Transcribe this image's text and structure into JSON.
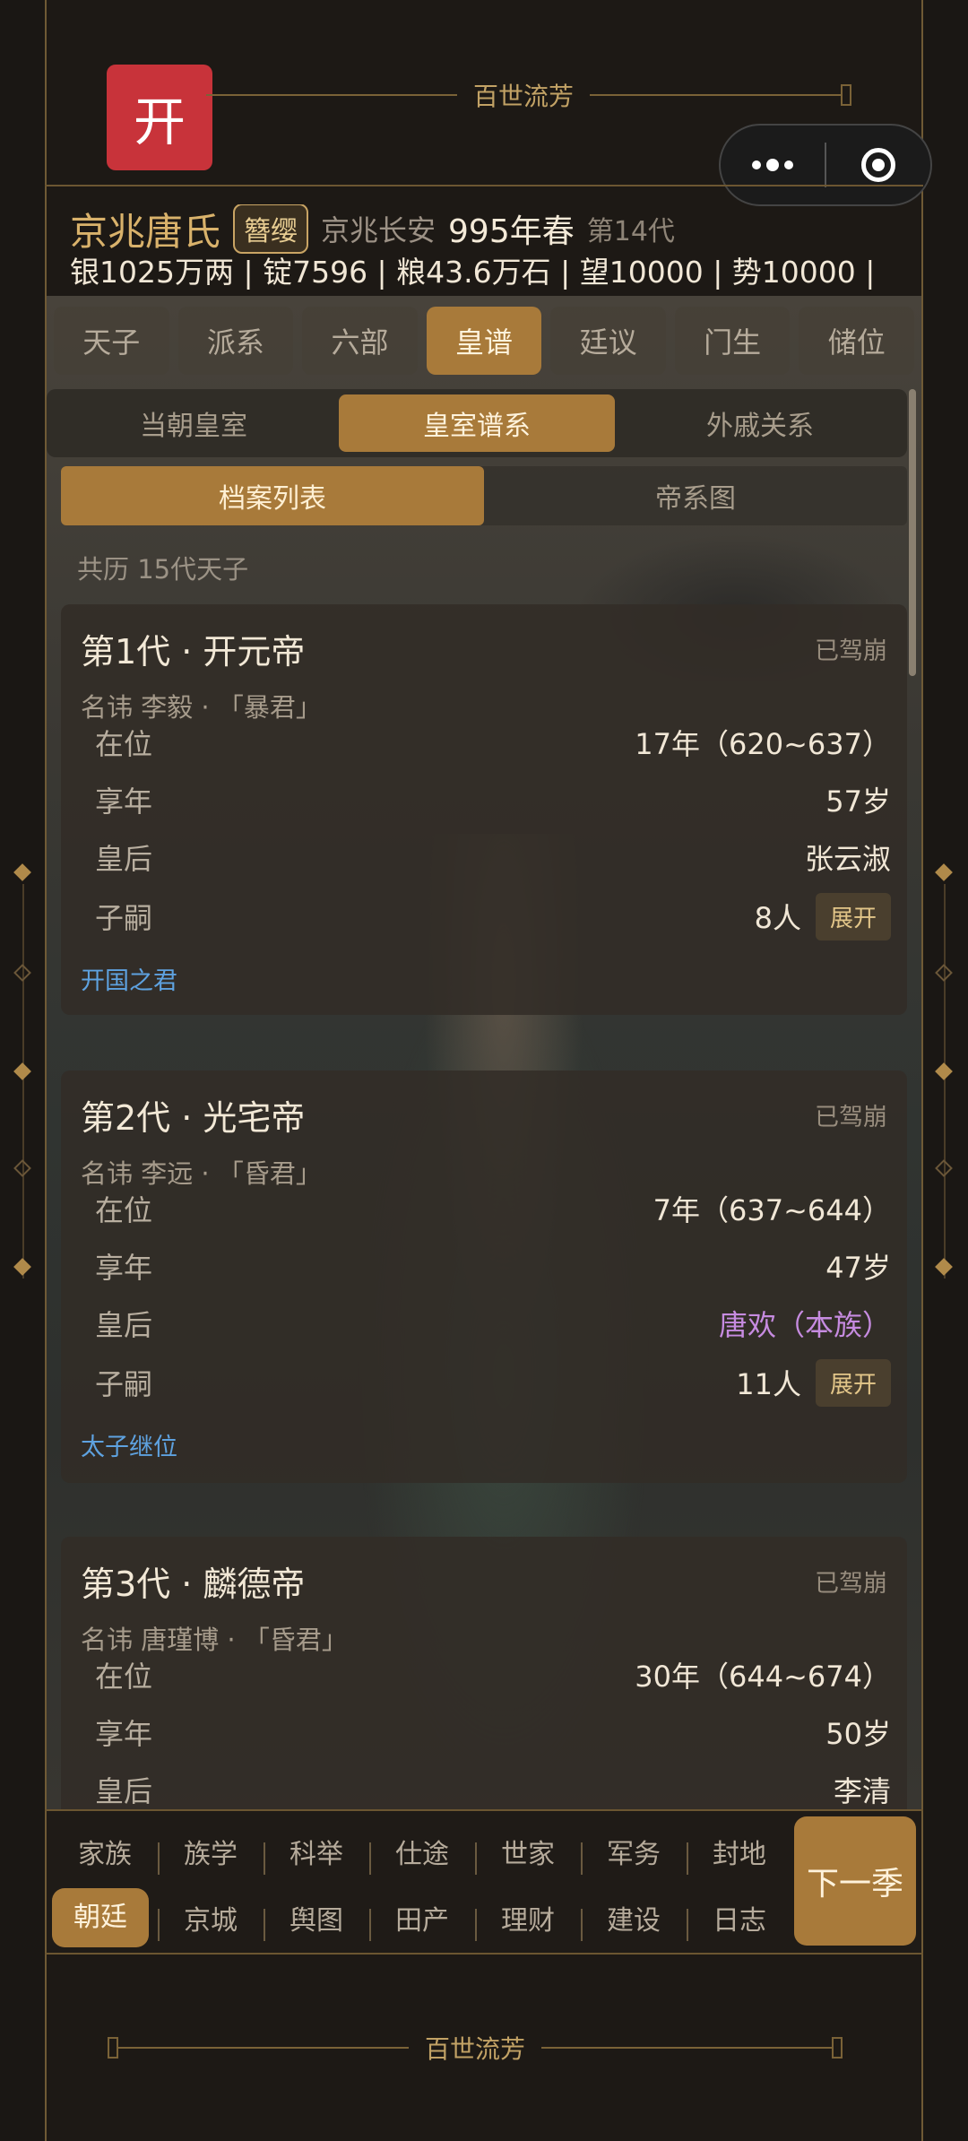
{
  "header": {
    "open_label": "开",
    "banner_text": "百世流芳",
    "clan": "京兆唐氏",
    "badge": "簪缨",
    "location": "京兆长安",
    "year": "995年春",
    "generation": "第14代",
    "resources": "银1025万两 | 锭7596 | 粮43.6万石 | 望10000 | 势10000 |"
  },
  "tabs_main": [
    "天子",
    "派系",
    "六部",
    "皇谱",
    "廷议",
    "门生",
    "储位"
  ],
  "tabs_sub": [
    "当朝皇室",
    "皇室谱系",
    "外戚关系"
  ],
  "tabs_view": [
    "档案列表",
    "帝系图"
  ],
  "count_text": "共历 15代天子",
  "labels": {
    "reign": "在位",
    "lifespan": "享年",
    "empress": "皇后",
    "heirs": "子嗣",
    "expand": "展开"
  },
  "emperors": [
    {
      "title": "第1代 · 开元帝",
      "status": "已驾崩",
      "name_line": "名讳 李毅 · 「暴君」",
      "reign": "17年（620~637）",
      "lifespan": "57岁",
      "empress": "张云淑",
      "heirs": "8人",
      "tag": "开国之君"
    },
    {
      "title": "第2代 · 光宅帝",
      "status": "已驾崩",
      "name_line": "名讳 李远 · 「昏君」",
      "reign": "7年（637~644）",
      "lifespan": "47岁",
      "empress": "唐欢（本族）",
      "heirs": "11人",
      "tag": "太子继位"
    },
    {
      "title": "第3代 · 麟德帝",
      "status": "已驾崩",
      "name_line": "名讳 唐瑾博 · 「昏君」",
      "reign": "30年（644~674）",
      "lifespan": "50岁",
      "empress": "李清"
    }
  ],
  "bottom_nav": {
    "row1": [
      "家族",
      "族学",
      "科举",
      "仕途",
      "世家",
      "军务",
      "封地"
    ],
    "row2": [
      "朝廷",
      "京城",
      "舆图",
      "田产",
      "理财",
      "建设",
      "日志"
    ],
    "next": "下一季"
  },
  "footer_banner": "百世流芳",
  "colors": {
    "accent": "#a87a3a",
    "red": "#c8333a",
    "gold": "#d9b26b",
    "link": "#5ea2e0",
    "purple": "#c68be0"
  }
}
